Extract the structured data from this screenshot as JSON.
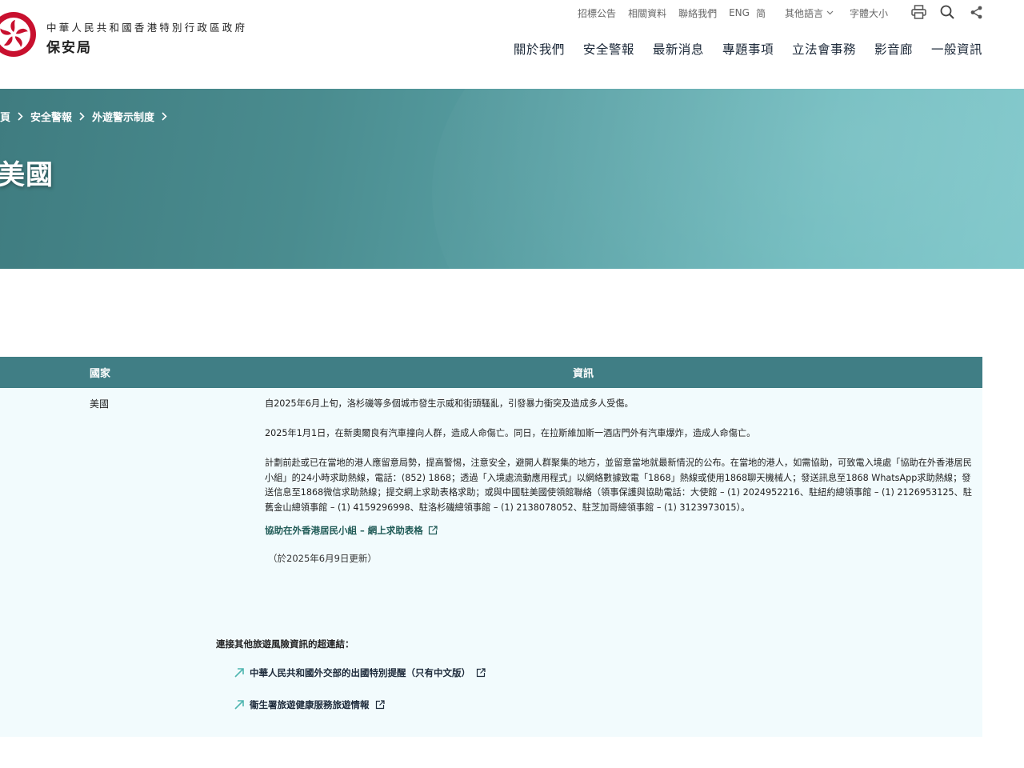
{
  "header": {
    "gov_name": "中華人民共和國香港特別行政區政府",
    "bureau_name": "保安局",
    "util_links": [
      "招標公告",
      "相關資料",
      "聯絡我們"
    ],
    "lang_eng": "ENG",
    "lang_sc": "简",
    "other_lang": "其他語言",
    "font_size": "字體大小",
    "icons": [
      "print-icon",
      "search-icon",
      "share-icon"
    ],
    "nav": [
      "關於我們",
      "安全警報",
      "最新消息",
      "專題事項",
      "立法會事務",
      "影音廊",
      "一般資訊"
    ]
  },
  "banner": {
    "breadcrumb": [
      "頁",
      "安全警報",
      "外遊警示制度"
    ],
    "title": "美國"
  },
  "table": {
    "headers": {
      "country": "國家",
      "info": "資訊"
    },
    "country": "美國",
    "paragraphs": [
      "自2025年6月上旬，洛杉磯等多個城市發生示威和街頭騷亂，引發暴力衝突及造成多人受傷。",
      "2025年1月1日，在新奧爾良有汽車撞向人群，造成人命傷亡。同日，在拉斯維加斯一酒店門外有汽車爆炸，造成人命傷亡。",
      "計劃前赴或已在當地的港人應留意局勢，提高警惕，注意安全，避開人群聚集的地方，並留意當地就最新情況的公布。在當地的港人，如需協助，可致電入境處「協助在外香港居民小組」的24小時求助熱線，電話：(852) 1868；透過「入境處流動應用程式」以網絡數據致電「1868」熱線或使用1868聊天機械人；發送訊息至1868 WhatsApp求助熱線；發送信息至1868微信求助熱線；提交網上求助表格求助；或與中國駐美國使領館聯絡（領事保護與協助電話：大使館 – (1) 2024952216、駐紐約總領事館 – (1) 2126953125、駐舊金山總領事館 – (1) 4159296998、駐洛杉磯總領事館 – (1) 2138078052、駐芝加哥總領事館 – (1) 3123973015）。"
    ],
    "help_link": "協助在外香港居民小組 – 網上求助表格",
    "updated": "（於2025年6月9日更新）",
    "links_title": "連接其他旅遊風險資訊的超連結：",
    "links": [
      "中華人民共和國外交部的出國特別提醒（只有中文版）",
      "衞生署旅遊健康服務旅遊情報"
    ]
  },
  "colors": {
    "table_header": "#407e85",
    "table_body": "#f2fbfd",
    "link_green": "#1f5a56",
    "arrow_teal": "#4fb6b0"
  }
}
